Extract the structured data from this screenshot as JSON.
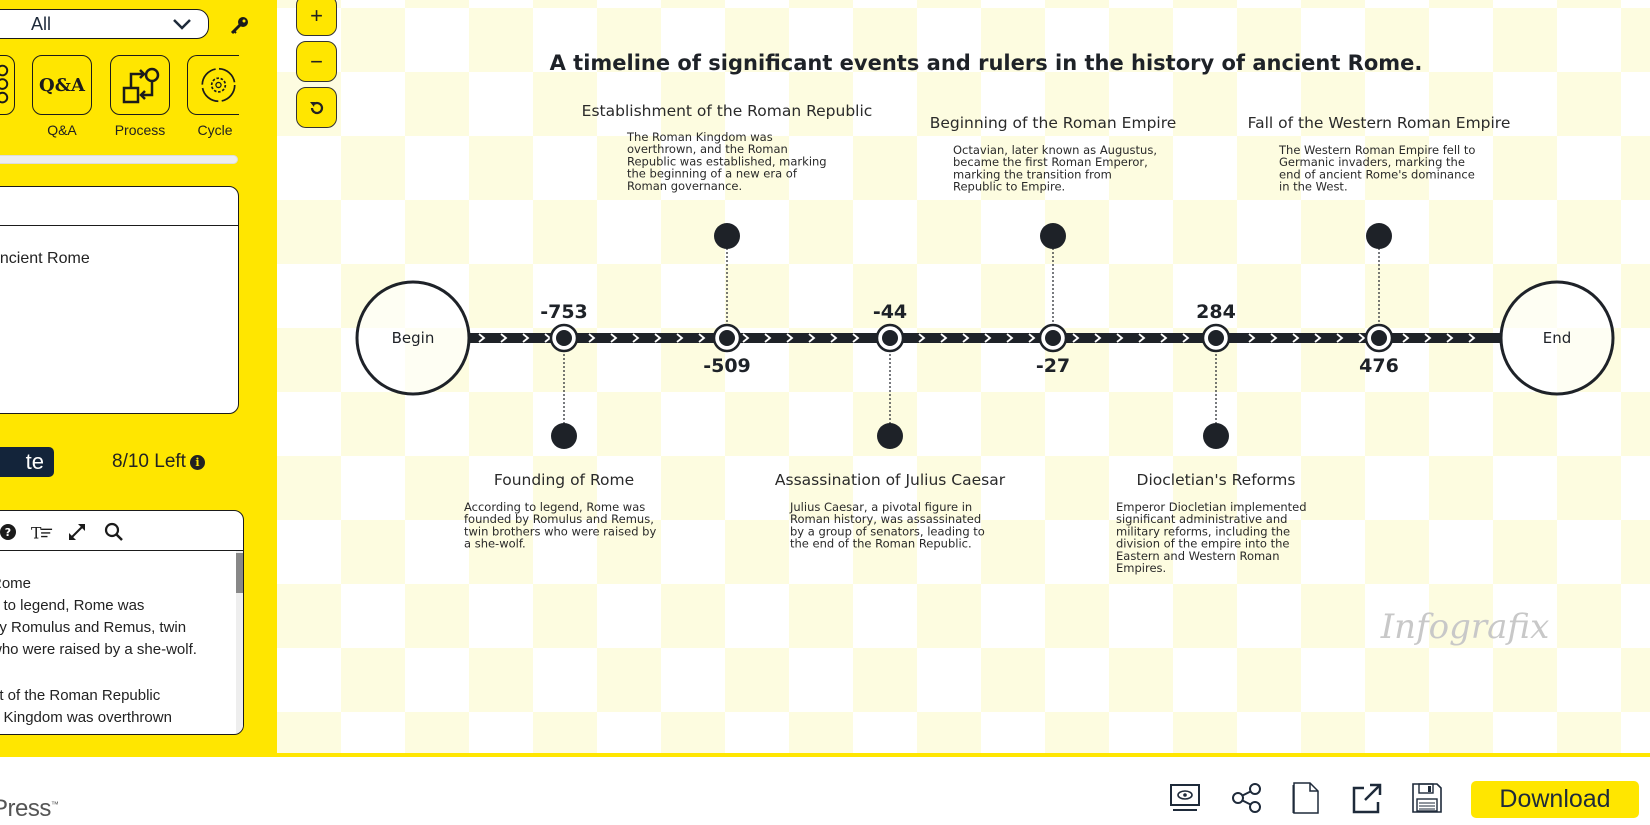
{
  "sidebar": {
    "filter": {
      "selected": "All"
    },
    "templates": [
      {
        "label": "",
        "icon": "list-icon"
      },
      {
        "label": "Q&A",
        "icon": "qa-icon",
        "glyph": "Q&A"
      },
      {
        "label": "Process",
        "icon": "process-icon"
      },
      {
        "label": "Cycle",
        "icon": "cycle-icon"
      }
    ],
    "prompt_text": "ancient Rome",
    "generate_label": "te",
    "credits": "8/10 Left",
    "editor_lines": [
      "",
      " Rome",
      "g to legend, Rome was",
      "by Romulus and Remus, twin",
      "who were raised by a she-wolf.",
      "",
      "nt of the Roman Republic",
      "n Kingdom was overthrown"
    ]
  },
  "canvas_controls": {
    "zoom_in": "+",
    "zoom_out": "−",
    "reset": "⟲"
  },
  "chart_data": {
    "type": "timeline",
    "title": "A timeline of significant events and rulers in the history of ancient Rome.",
    "start_label": "Begin",
    "end_label": "End",
    "events": [
      {
        "year": "-753",
        "title": "Founding of Rome",
        "desc": [
          "According to legend, Rome was",
          "founded by Romulus and Remus,",
          "twin brothers who were raised by",
          "a she-wolf."
        ],
        "side": "below"
      },
      {
        "year": "-509",
        "title": "Establishment of the Roman Republic",
        "desc": [
          "The Roman Kingdom was",
          "overthrown, and the Roman",
          "Republic was established, marking",
          "the beginning of a new era of",
          "Roman governance."
        ],
        "side": "above"
      },
      {
        "year": "-44",
        "title": "Assassination of Julius Caesar",
        "desc": [
          "Julius Caesar, a pivotal figure in",
          "Roman history, was assassinated",
          "by a group of senators, leading to",
          "the end of the Roman Republic."
        ],
        "side": "below"
      },
      {
        "year": "-27",
        "title": "Beginning of the Roman Empire",
        "desc": [
          "Octavian, later known as Augustus,",
          "became the first Roman Emperor,",
          "marking the transition from",
          "Republic to Empire."
        ],
        "side": "above"
      },
      {
        "year": "284",
        "title": "Diocletian's Reforms",
        "desc": [
          "Emperor Diocletian implemented",
          "significant administrative and",
          "military reforms, including the",
          "division of the empire into the",
          "Eastern and Western Roman",
          "Empires."
        ],
        "side": "below"
      },
      {
        "year": "476",
        "title": "Fall of the Western Roman Empire",
        "desc": [
          "The Western Roman Empire fell to",
          "Germanic invaders, marking the",
          "end of ancient Rome's dominance",
          "in the West."
        ],
        "side": "above"
      }
    ],
    "watermark": "Infografix"
  },
  "bottom_bar": {
    "brand": "Press",
    "download_label": "Download"
  },
  "colors": {
    "accent": "#ffe600",
    "dark": "#1e2228",
    "navy": "#13243a",
    "cream": "#fdfce0"
  }
}
